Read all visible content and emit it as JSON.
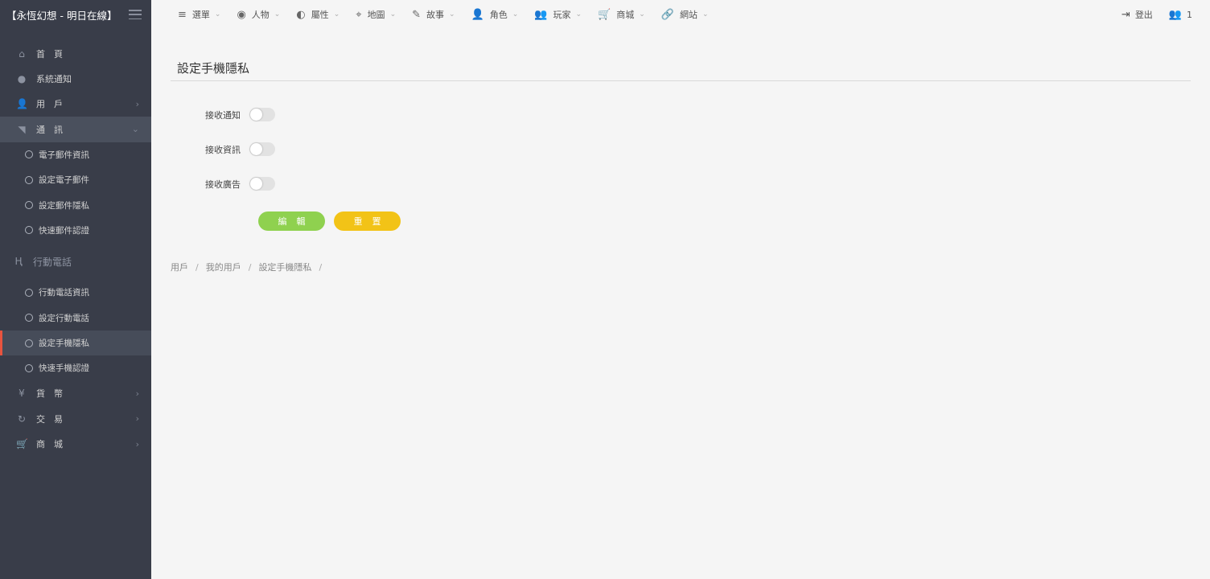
{
  "brand": {
    "title": "【永恆幻想 - 明日在線】"
  },
  "sidebar": {
    "items": [
      {
        "label": "首　頁",
        "icon": "home-icon",
        "glyph": "⌂"
      },
      {
        "label": "系統通知",
        "icon": "chat-icon",
        "glyph": "●"
      },
      {
        "label": "用　戶",
        "icon": "user-icon",
        "glyph": "👤"
      },
      {
        "label": "通　訊",
        "icon": "signal-icon",
        "glyph": "◥"
      }
    ],
    "comm_sub": [
      "電子郵件資訊",
      "設定電子郵件",
      "設定郵件隱私",
      "快速郵件認證"
    ],
    "mobile_group": {
      "label": "行動電話",
      "glyph": "Ⱨ"
    },
    "mobile_sub": [
      "行動電話資訊",
      "設定行動電話",
      "設定手機隱私",
      "快速手機認證"
    ],
    "bottom_items": [
      {
        "label": "貨　幣",
        "icon": "currency-icon",
        "glyph": "¥"
      },
      {
        "label": "交　易",
        "icon": "trade-icon",
        "glyph": "↻"
      },
      {
        "label": "商　城",
        "icon": "cart-icon",
        "glyph": "🛒"
      }
    ]
  },
  "topnav": {
    "items": [
      {
        "label": "選單",
        "glyph": "≡"
      },
      {
        "label": "人物",
        "glyph": "◉"
      },
      {
        "label": "屬性",
        "glyph": "◐"
      },
      {
        "label": "地圖",
        "glyph": "⌖"
      },
      {
        "label": "故事",
        "glyph": "✎"
      },
      {
        "label": "角色",
        "glyph": "👤"
      },
      {
        "label": "玩家",
        "glyph": "👥"
      },
      {
        "label": "商城",
        "glyph": "🛒"
      },
      {
        "label": "網站",
        "glyph": "🔗"
      }
    ],
    "logout": "登出",
    "users_count": "1"
  },
  "page": {
    "title": "設定手機隱私",
    "fields": [
      {
        "label": "接收通知",
        "on": false
      },
      {
        "label": "接收資訊",
        "on": false
      },
      {
        "label": "接收廣告",
        "on": false
      }
    ],
    "edit_button": "編輯",
    "reset_button": "重置",
    "colors": {
      "edit": "#8fd14f",
      "reset": "#f2c317",
      "active_marker": "#e8543f"
    }
  },
  "breadcrumb": [
    "用戶",
    "我的用戶",
    "設定手機隱私"
  ]
}
